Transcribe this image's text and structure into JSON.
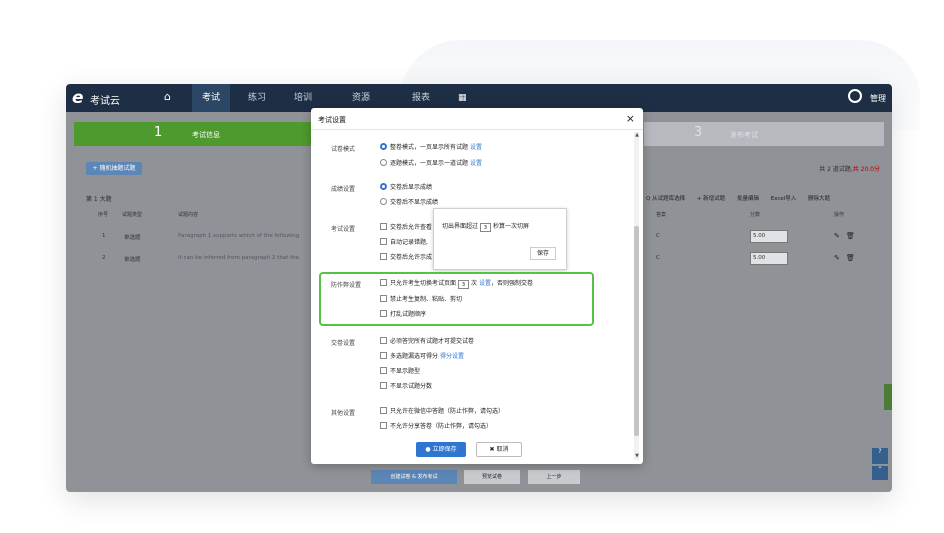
{
  "app": {
    "brand": "考试云",
    "nav": [
      "考试",
      "练习",
      "培训",
      "资源",
      "报表"
    ],
    "nav_active": "考试",
    "manage": "管理"
  },
  "steps": {
    "step1_num": "1",
    "step1_label": "考试信息",
    "step3_num": "3",
    "step3_label": "发布考试"
  },
  "list": {
    "add_button": "+ 随机抽题试题",
    "summary": "第 1 大题",
    "summary_right_prefix": "共 2 道试题,",
    "summary_right_total": "共 20.0分",
    "tools": [
      "Q 从试题库选择",
      "+ 新增试题",
      "批量编辑",
      "Excel导入",
      "删除大题"
    ],
    "headers": [
      "序号",
      "试题类型",
      "试题内容",
      "答案",
      "分数",
      "操作"
    ],
    "rows": [
      {
        "num": "1",
        "type": "单选题",
        "content": "Paragraph 1 supports which of the following",
        "answer": "C",
        "score": "5.00"
      },
      {
        "num": "2",
        "type": "单选题",
        "content": "It can be inferred from paragraph 2 that the",
        "answer": "C",
        "score": "5.00"
      }
    ],
    "bottom_buttons": [
      "创建试卷 & 发布考试",
      "预览试卷",
      "上一步"
    ]
  },
  "modal": {
    "title": "考试设置",
    "sections": {
      "mode": "试卷模式",
      "result": "成绩设置",
      "exam": "考试设置",
      "anticheat": "防作弊设置",
      "submit": "交卷设置",
      "other": "其他设置"
    },
    "options": {
      "mode_all": "整卷模式，一页显示所有试题",
      "mode_single": "逐题模式，一页显示一道试题",
      "result_show": "交卷后显示成绩",
      "result_hide": "交卷后不显示成绩",
      "exam_1": "交卷后允许查看",
      "exam_2": "自动记录错题,",
      "exam_3": "交卷后允许示成",
      "anti_1_pre": "只允许考生切换考试页面",
      "anti_1_val": "3",
      "anti_1_mid": "次",
      "anti_1_link": "设置",
      "anti_1_post": "，否则强制交卷",
      "anti_2": "禁止考生复制、粘贴、剪切",
      "anti_3": "打乱试题顺序",
      "sub_1": "必须答完所有试题才可提交试卷",
      "sub_2": "多选题漏选可得分",
      "sub_2_link": "得分设置",
      "sub_3": "不显示题型",
      "sub_4": "不显示试题分数",
      "other_1": "只允许在微信中答题（防止作弊，请勾选）",
      "other_2": "不允许分享答卷（防止作弊，请勾选）"
    },
    "popover": {
      "pre": "切出界面超过",
      "val": "3",
      "post": "秒算一次切屏",
      "save": "保存"
    },
    "save_button": "● 立即保存",
    "cancel_button": "✖ 取消"
  }
}
